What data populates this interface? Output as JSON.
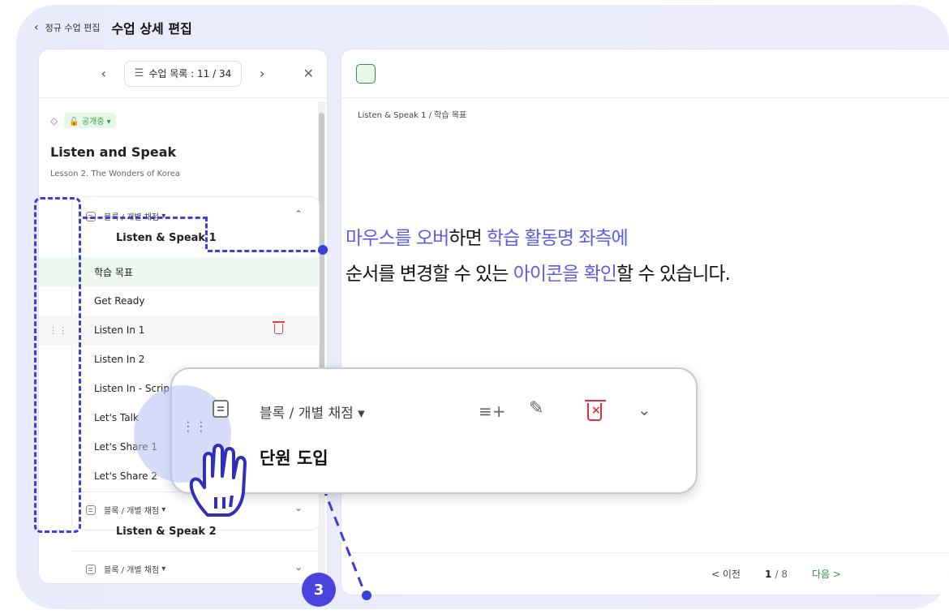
{
  "header": {
    "back_label": "정규 수업 편집",
    "title": "수업 상세 편집"
  },
  "left_panel": {
    "lesson_list_label": "수업 목록 : 11 / 34",
    "status": "공개중",
    "lesson_title": "Listen and Speak",
    "lesson_subtitle": "Lesson 2. The Wonders of Korea",
    "block1": {
      "tag": "블록 / 개별 채점",
      "title": "Listen & Speak 1",
      "items": [
        "학습 목표",
        "Get Ready",
        "Listen In 1",
        "Listen In 2",
        "Listen In - Scrip",
        "Let's Talk",
        "Let's Share 1",
        "Let's Share 2"
      ]
    },
    "block2": {
      "tag": "블록 / 개별 채점",
      "title": "Listen & Speak 2"
    },
    "block3": {
      "tag": "블록 / 개별 채점"
    }
  },
  "right_panel": {
    "breadcrumb": "Listen & Speak 1  /  학습 목표",
    "prev_label": "< 이전",
    "page_current": "1",
    "page_total": "/ 8",
    "next_label": "다음 >"
  },
  "hint": {
    "line1_a": "마우스를 오버",
    "line1_b": "하면 ",
    "line1_c": "학습 활동명 좌측에",
    "line2_a": "순서를 변경할 수 있는 ",
    "line2_b": "아이콘을 확인",
    "line2_c": "할 수 있습니다."
  },
  "popover": {
    "tag": "블록 / 개별 채점",
    "title": "단원 도입"
  },
  "step_number": "3",
  "icons": [
    "back-chevron-icon",
    "list-icon",
    "close-icon",
    "cube-icon",
    "lock-icon",
    "doc-icon",
    "chevron-up-icon",
    "chevron-down-icon",
    "drag-handle-icon",
    "trash-icon",
    "insert-list-icon",
    "pencil-icon",
    "hand-cursor-icon"
  ],
  "colors": {
    "accent": "#5a5cf0",
    "dash": "#3a3fd8",
    "step_badge": "#4a43de",
    "danger": "#e0303a",
    "green": "#2c8f44"
  }
}
